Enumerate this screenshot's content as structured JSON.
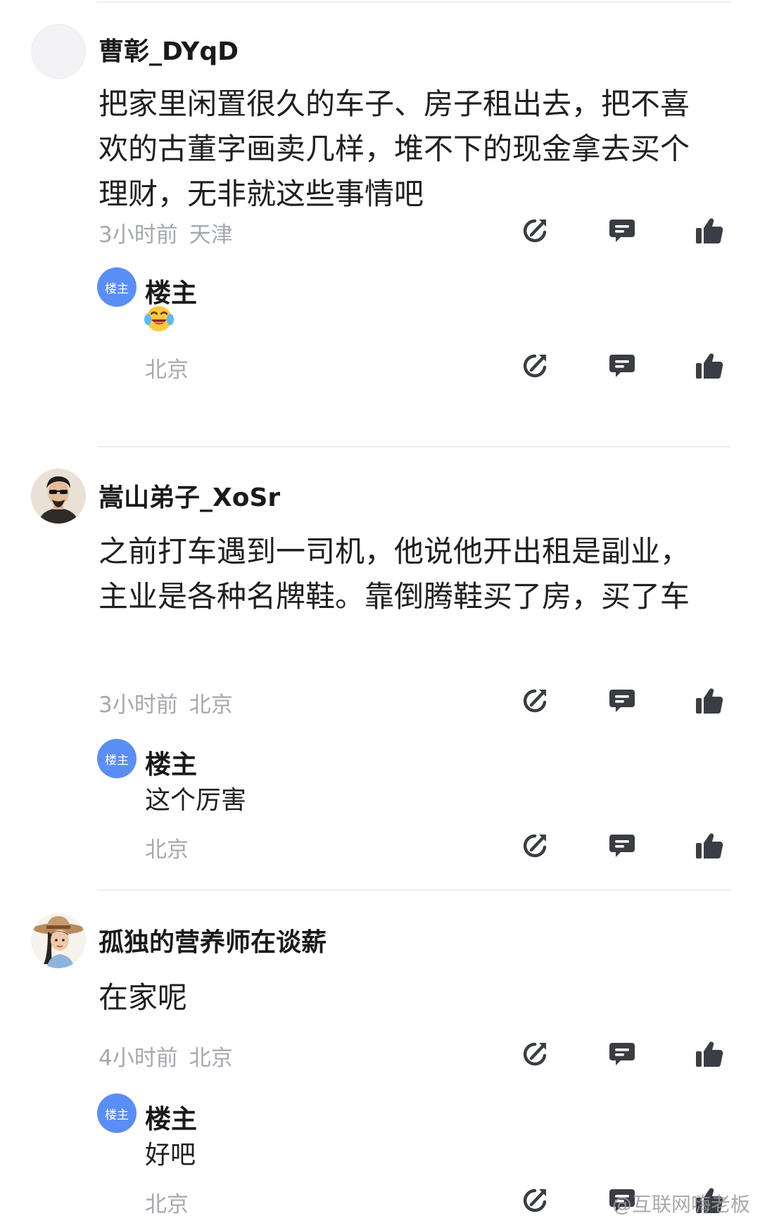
{
  "comments": [
    {
      "username": "曹彰_DYqD",
      "text": "把家里闲置很久的车子、房子租出去，把不喜欢的古董字画卖几样，堆不下的现金拿去买个理财，无非就这些事情吧",
      "time": "3小时前",
      "location": "天津",
      "avatar": "blank-avatar",
      "reply": {
        "badge": "楼主",
        "name": "楼主",
        "text": "",
        "emoji": "laughing-tears-emoji",
        "location": "北京"
      }
    },
    {
      "username": "嵩山弟子_XoSr",
      "text": "之前打车遇到一司机，他说他开出租是副业，主业是各种名牌鞋。靠倒腾鞋买了房，买了车",
      "time": "3小时前",
      "location": "北京",
      "avatar": "man-sunglasses-avatar",
      "reply": {
        "badge": "楼主",
        "name": "楼主",
        "text": "这个厉害",
        "location": "北京"
      }
    },
    {
      "username": "孤独的营养师在谈薪",
      "text": "在家呢",
      "time": "4小时前",
      "location": "北京",
      "avatar": "woman-hat-avatar",
      "reply": {
        "badge": "楼主",
        "name": "楼主",
        "text": "好吧",
        "location": "北京"
      }
    }
  ],
  "icons": [
    "share-icon",
    "reply-icon",
    "like-icon"
  ],
  "colors": {
    "op_badge": "#5a8ef5",
    "meta_text": "#a6a8b0",
    "icon": "#3a3d44"
  },
  "watermark": "@互联网嗨老板"
}
